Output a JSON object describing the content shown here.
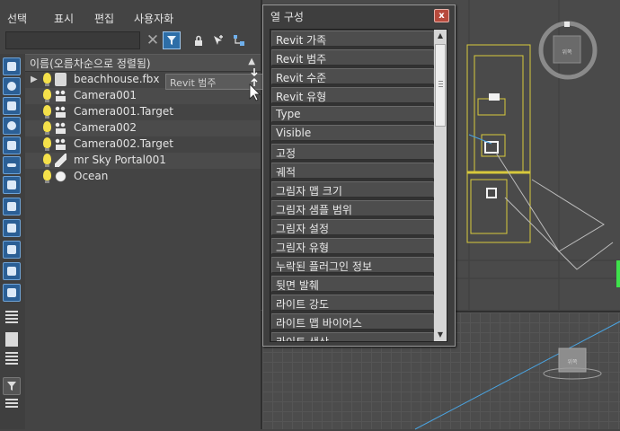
{
  "menu": [
    "선택",
    "표시",
    "편집",
    "사용자화"
  ],
  "search": {
    "value": "",
    "placeholder": ""
  },
  "toolbar_icons": [
    "clear-icon",
    "filter-icon",
    "lock-icon",
    "add-icon",
    "hierarchy-icon"
  ],
  "tree": {
    "header_label": "이름(오름차순으로 정렬됨)",
    "sort_indicator": "▲",
    "rows": [
      {
        "label": "beachhouse.fbx",
        "icon": "file-icon",
        "expandable": true
      },
      {
        "label": "Camera001",
        "icon": "camera-icon"
      },
      {
        "label": "Camera001.Target",
        "icon": "camera-icon"
      },
      {
        "label": "Camera002",
        "icon": "camera-icon"
      },
      {
        "label": "Camera002.Target",
        "icon": "camera-icon"
      },
      {
        "label": "mr Sky Portal001",
        "icon": "portal-icon"
      },
      {
        "label": "Ocean",
        "icon": "sphere-icon"
      }
    ]
  },
  "drag_ghost": {
    "label": "Revit 범주"
  },
  "dialog": {
    "title": "열 구성",
    "close_label": "x",
    "items": [
      "Revit 가족",
      "Revit 범주",
      "Revit 수준",
      "Revit 유형",
      "Type",
      "Visible",
      "고정",
      "궤적",
      "그림자 맵 크기",
      "그림자 샘플 범위",
      "그림자 설정",
      "그림자 유형",
      "누락된 플러그인 정보",
      "뒷면 발췌",
      "라이트 강도",
      "라이트 맵 바이어스",
      "라이트 색상"
    ]
  },
  "viewport_labels": {
    "top_compass": "위쪽",
    "bottom_cube": "위쪽"
  },
  "colors": {
    "accent_blue": "#2d6ea8",
    "yellow": "#f4e04a",
    "close_red": "#b74a3c"
  }
}
